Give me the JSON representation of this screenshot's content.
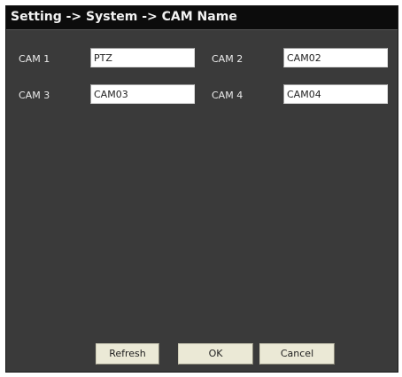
{
  "title": "Setting -> System -> CAM Name",
  "cameras": [
    {
      "label": "CAM 1",
      "value": "PTZ"
    },
    {
      "label": "CAM 2",
      "value": "CAM02"
    },
    {
      "label": "CAM 3",
      "value": "CAM03"
    },
    {
      "label": "CAM 4",
      "value": "CAM04"
    }
  ],
  "buttons": {
    "refresh": "Refresh",
    "ok": "OK",
    "cancel": "Cancel"
  },
  "colors": {
    "background": "#3a3a3a",
    "titlebar": "#0c0c0c",
    "button": "#ebe9d6"
  }
}
